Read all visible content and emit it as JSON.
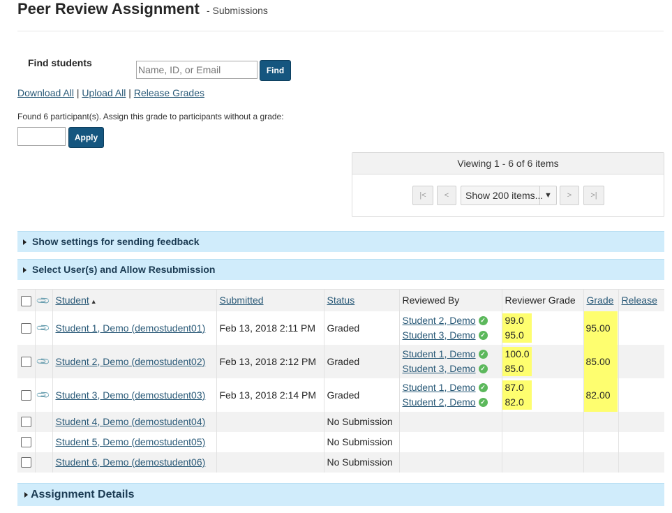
{
  "header": {
    "title": "Peer Review Assignment",
    "subtitle": "- Submissions"
  },
  "find": {
    "label": "Find students",
    "placeholder": "Name, ID, or Email",
    "button": "Find"
  },
  "bulk_links": {
    "download_all": "Download All",
    "upload_all": "Upload All",
    "release_grades": "Release Grades",
    "separator": "|"
  },
  "assign_grade": {
    "text": "Found 6 participant(s). Assign this grade to participants without a grade:",
    "value": "",
    "button": "Apply"
  },
  "pager": {
    "viewing": "Viewing 1 - 6 of 6 items",
    "first": "|<",
    "prev": "<",
    "page_size": "Show 200 items...",
    "next": ">",
    "last": ">|"
  },
  "sections": {
    "feedback": "Show settings for sending feedback",
    "resubmission": "Select User(s) and Allow Resubmission",
    "details": "Assignment Details"
  },
  "table": {
    "headers": {
      "student": "Student",
      "submitted": "Submitted",
      "status": "Status",
      "reviewed_by": "Reviewed By",
      "reviewer_grade": "Reviewer Grade",
      "grade": "Grade",
      "release": "Release"
    },
    "rows": [
      {
        "student": "Student 1, Demo (demostudent01)",
        "submitted": "Feb 13, 2018 2:11 PM",
        "status": "Graded",
        "reviewers": [
          "Student 2, Demo",
          "Student 3, Demo"
        ],
        "reviewer_grades": [
          "99.0",
          "95.0"
        ],
        "grade": "95.00"
      },
      {
        "student": "Student 2, Demo (demostudent02)",
        "submitted": "Feb 13, 2018 2:12 PM",
        "status": "Graded",
        "reviewers": [
          "Student 1, Demo",
          "Student 3, Demo"
        ],
        "reviewer_grades": [
          "100.0",
          "85.0"
        ],
        "grade": "85.00"
      },
      {
        "student": "Student 3, Demo (demostudent03)",
        "submitted": "Feb 13, 2018 2:14 PM",
        "status": "Graded",
        "reviewers": [
          "Student 1, Demo",
          "Student 2, Demo"
        ],
        "reviewer_grades": [
          "87.0",
          "82.0"
        ],
        "grade": "82.00"
      },
      {
        "student": "Student 4, Demo (demostudent04)",
        "status": "No Submission"
      },
      {
        "student": "Student 5, Demo (demostudent05)",
        "status": "No Submission"
      },
      {
        "student": "Student 6, Demo (demostudent06)",
        "status": "No Submission"
      }
    ]
  },
  "colors": {
    "primary_button": "#15567f",
    "section_bar": "#d0ecfb",
    "highlight": "#fefe6f",
    "link": "#2a5a78",
    "check": "#5cb85c"
  },
  "icons": {
    "paperclip": "paperclip-icon",
    "sort": "sort-ascending-icon",
    "check": "check-circle-icon",
    "expand": "caret-right-icon"
  }
}
